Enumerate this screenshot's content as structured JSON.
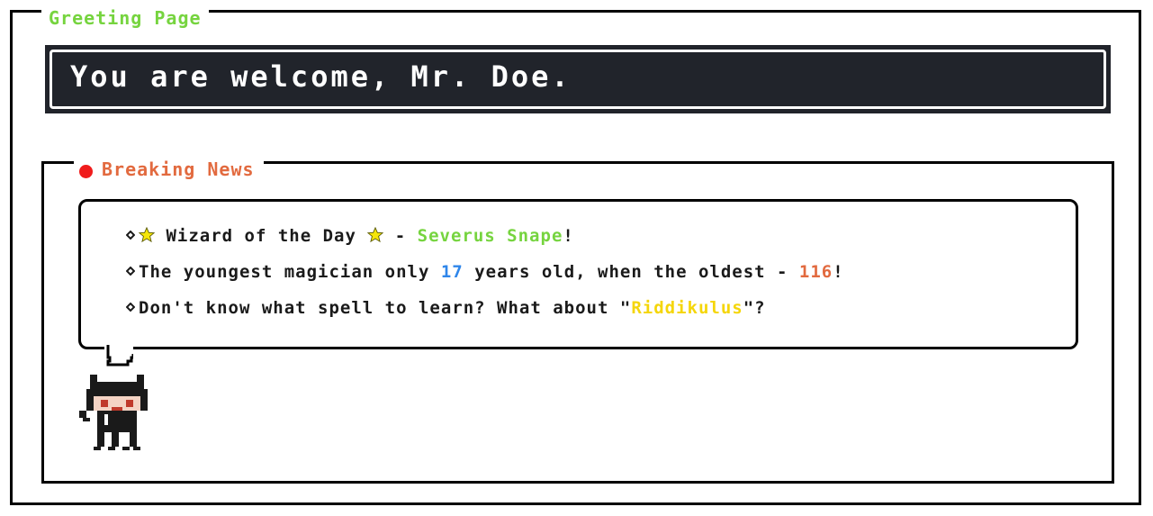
{
  "greeting_page": {
    "legend": "Greeting Page",
    "welcome_text": "You are welcome, Mr. Doe."
  },
  "breaking_news": {
    "legend": "Breaking News",
    "indicator_color": "#f01c1c",
    "items": [
      {
        "parts": [
          {
            "text": "",
            "icon": "star-icon"
          },
          {
            "text": " Wizard of the Day "
          },
          {
            "text": "",
            "icon": "star-icon"
          },
          {
            "text": " - "
          },
          {
            "text": "Severus Snape",
            "color": "#76d43f"
          },
          {
            "text": "!"
          }
        ]
      },
      {
        "parts": [
          {
            "text": "The youngest magician only "
          },
          {
            "text": "17",
            "color": "#2f86ea"
          },
          {
            "text": " years old, when the oldest - "
          },
          {
            "text": "116",
            "color": "#e26a3f"
          },
          {
            "text": "!"
          }
        ]
      },
      {
        "parts": [
          {
            "text": "Don't know what spell to learn? What about \""
          },
          {
            "text": "Riddikulus",
            "color": "#f5d60a"
          },
          {
            "text": "\"?"
          }
        ]
      }
    ],
    "mascot": "octocat-pixel-icon"
  },
  "colors": {
    "green_accent": "#76d43f",
    "orange_accent": "#e26a3f",
    "blue_accent": "#2f86ea",
    "yellow_accent": "#f5d60a",
    "dark_panel": "#21242b"
  }
}
